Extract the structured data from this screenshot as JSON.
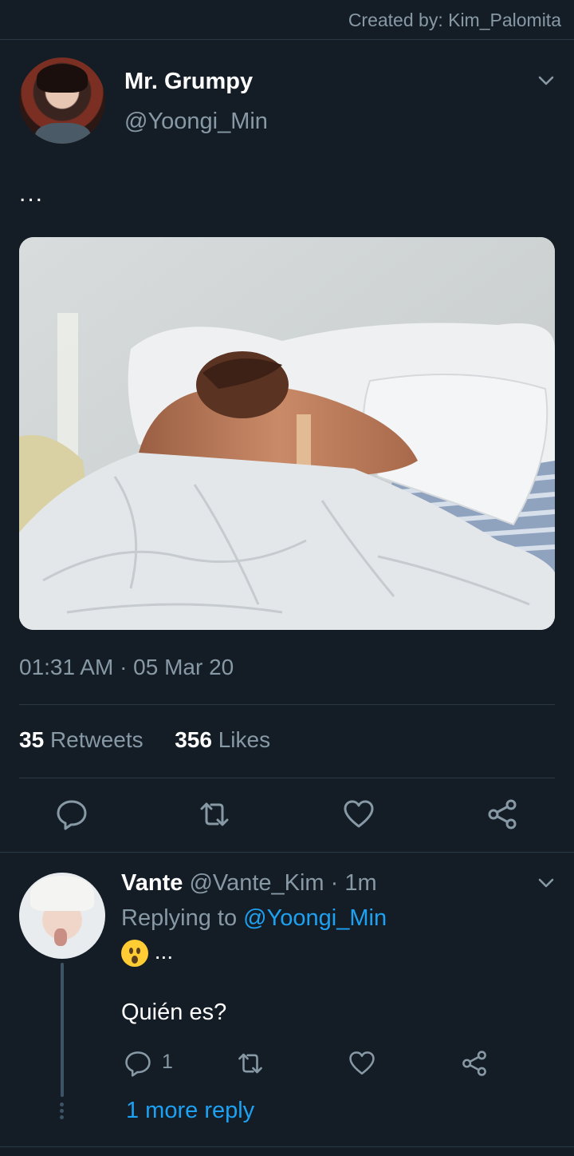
{
  "credit": "Created by: Kim_Palomita",
  "tweet": {
    "display_name": "Mr. Grumpy",
    "handle": "@Yoongi_Min",
    "text": "...",
    "timestamp": "01:31 AM · 05 Mar 20",
    "retweets_count": "35",
    "retweets_label": "Retweets",
    "likes_count": "356",
    "likes_label": "Likes"
  },
  "reply": {
    "display_name": "Vante",
    "handle": "@Vante_Kim",
    "time": "· 1m",
    "replying_prefix": "Replying to",
    "replying_to": "@Yoongi_Min",
    "emoji_suffix": "...",
    "text": "Quién es?",
    "reply_count": "1",
    "more_replies": "1 more reply"
  },
  "colors": {
    "background": "#141d26",
    "secondary_text": "#8899a6",
    "accent": "#1da1f2"
  },
  "icons": {
    "reply": "speech-bubble-icon",
    "retweet": "retweet-icon",
    "like": "heart-icon",
    "share": "share-icon",
    "menu": "chevron-down-icon",
    "emoji": "hushed-face-emoji"
  }
}
